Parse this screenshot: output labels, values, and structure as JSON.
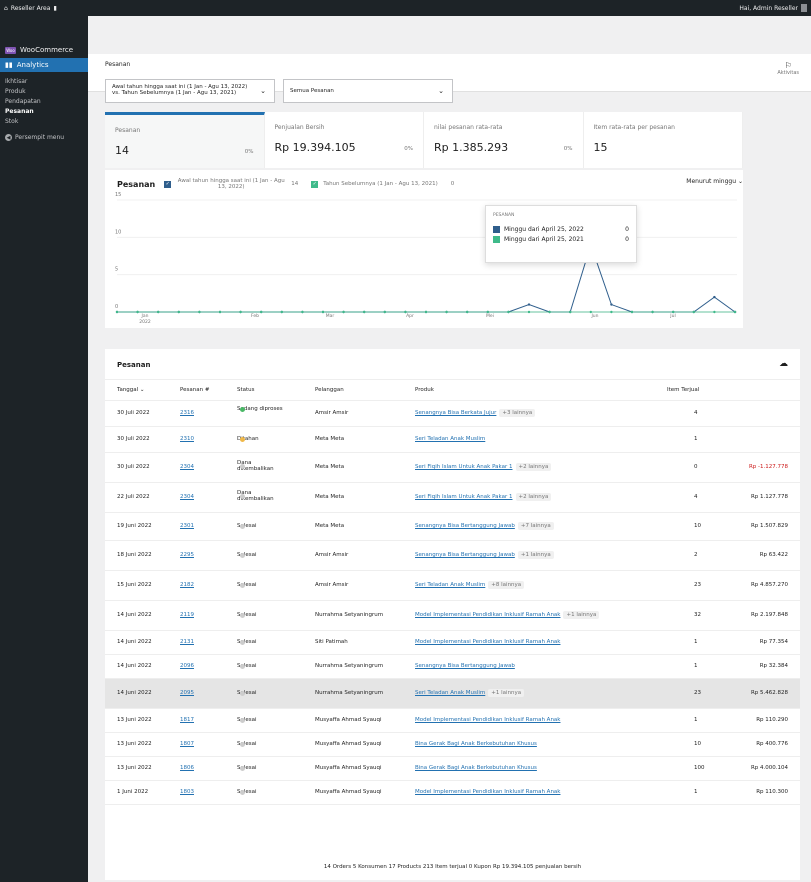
{
  "adminbar": {
    "site_title": "Reseller Area",
    "greeting": "Hai, Admin Reseller"
  },
  "sidebar": {
    "woocommerce": "WooCommerce",
    "analytics": "Analytics",
    "items": [
      {
        "label": "Ikhtisar"
      },
      {
        "label": "Produk"
      },
      {
        "label": "Pendapatan"
      },
      {
        "label": "Pesanan",
        "active": true
      },
      {
        "label": "Stok"
      }
    ],
    "collapse": "Persempit menu"
  },
  "header": {
    "title": "Pesanan",
    "activity": "Aktivitas"
  },
  "filters": {
    "date_range_line1": "Awal tahun hingga saat ini (1 Jan - Agu 13, 2022)",
    "date_range_line2": "vs. Tahun Sebelumnya (1 Jan - Agu 13, 2021)",
    "order_filter": "Semua Pesanan"
  },
  "summary": [
    {
      "label": "Pesanan",
      "value": "14",
      "pct": "0%"
    },
    {
      "label": "Penjualan Bersih",
      "value": "Rp 19.394.105",
      "pct": "0%"
    },
    {
      "label": "nilai pesanan rata-rata",
      "value": "Rp 1.385.293",
      "pct": "0%"
    },
    {
      "label": "Item rata-rata per pesanan",
      "value": "15",
      "pct": ""
    }
  ],
  "chart_header": {
    "title": "Pesanan",
    "series1_label": "Awal tahun hingga saat ini (1 Jan - Agu 13, 2022)",
    "series1_value": "14",
    "series2_label": "Tahun Sebelumnya (1 Jan - Agu 13, 2021)",
    "series2_value": "0",
    "interval": "Menurut minggu"
  },
  "tooltip": {
    "title": "PESANAN",
    "row1_label": "Minggu dari April 25, 2022",
    "row1_value": "0",
    "row2_label": "Minggu dari April 25, 2021",
    "row2_value": "0"
  },
  "colors": {
    "series1": "#2f5e8c",
    "series2": "#3fba8a",
    "accent": "#2271b1"
  },
  "chart_data": {
    "type": "line",
    "title": "Pesanan",
    "y_ticks": [
      "15",
      "10",
      "5",
      "0"
    ],
    "ylim": [
      0,
      15
    ],
    "x_tick_labels": [
      "Jan\n2022",
      "Feb",
      "Mar",
      "Apr",
      "Mei",
      "Jun",
      "Jul"
    ],
    "series": [
      {
        "name": "Awal tahun hingga saat ini (1 Jan - Agu 13, 2022)",
        "values": [
          0,
          0,
          0,
          0,
          0,
          0,
          0,
          0,
          0,
          0,
          0,
          0,
          0,
          0,
          0,
          0,
          0,
          0,
          0,
          0,
          1,
          0,
          0,
          9,
          1,
          0,
          0,
          0,
          0,
          2,
          0
        ]
      },
      {
        "name": "Tahun Sebelumnya (1 Jan - Agu 13, 2021)",
        "values": [
          0,
          0,
          0,
          0,
          0,
          0,
          0,
          0,
          0,
          0,
          0,
          0,
          0,
          0,
          0,
          0,
          0,
          0,
          0,
          0,
          0,
          0,
          0,
          0,
          0,
          0,
          0,
          0,
          0,
          0,
          0
        ]
      }
    ]
  },
  "table": {
    "title": "Pesanan",
    "columns": [
      "Tanggal",
      "Pesanan #",
      "Status",
      "Pelanggan",
      "Produk",
      "Item Terjual"
    ],
    "rows": [
      {
        "date": "30 Juli 2022",
        "order": "2316",
        "status": "Sedang diproses",
        "dot": "#4ab866",
        "customer": "Amsir Amsir",
        "product": "Senangnya Bisa Berkata Jujur",
        "more": "+3 lainnya",
        "items": "4",
        "total": ""
      },
      {
        "date": "30 Juli 2022",
        "order": "2310",
        "status": "Ditahan",
        "dot": "#f0b849",
        "customer": "Meta Meta",
        "product": "Seri Teladan Anak Muslim",
        "more": "",
        "items": "1",
        "total": ""
      },
      {
        "date": "30 Juli 2022",
        "order": "2304",
        "status": "Dana dikembalikan",
        "dot": "#ccc",
        "customer": "Meta Meta",
        "product": "Seri Fiqih Islam Untuk Anak Pakar 1",
        "more": "+2 lainnya",
        "items": "0",
        "total": "Rp -1.127.778",
        "neg": true
      },
      {
        "date": "22 Juli 2022",
        "order": "2304",
        "status": "Dana dikembalikan",
        "dot": "#ccc",
        "customer": "Meta Meta",
        "product": "Seri Fiqih Islam Untuk Anak Pakar 1",
        "more": "+2 lainnya",
        "items": "4",
        "total": "Rp 1.127.778"
      },
      {
        "date": "19 Juni 2022",
        "order": "2301",
        "status": "Selesai",
        "dot": "#ccc",
        "customer": "Meta Meta",
        "product": "Senangnya Bisa Bertanggung Jawab",
        "more": "+7 lainnya",
        "items": "10",
        "total": "Rp 1.507.829"
      },
      {
        "date": "18 Juni 2022",
        "order": "2295",
        "status": "Selesai",
        "dot": "#ccc",
        "customer": "Amsir Amsir",
        "product": "Senangnya Bisa Bertanggung Jawab",
        "more": "+1 lainnya",
        "items": "2",
        "total": "Rp 63.422"
      },
      {
        "date": "15 Juni 2022",
        "order": "2182",
        "status": "Selesai",
        "dot": "#ccc",
        "customer": "Amsir Amsir",
        "product": "Seri Teladan Anak Muslim",
        "more": "+8 lainnya",
        "items": "23",
        "total": "Rp 4.857.270"
      },
      {
        "date": "14 Juni 2022",
        "order": "2119",
        "status": "Selesai",
        "dot": "#ccc",
        "customer": "Nurrahma Setyaningrum",
        "product": "Model Implementasi Pendidikan Inklusif Ramah Anak",
        "more": "+1 lainnya",
        "items": "32",
        "total": "Rp 2.197.848"
      },
      {
        "date": "14 Juni 2022",
        "order": "2131",
        "status": "Selesai",
        "dot": "#ccc",
        "customer": "Siti Patimah",
        "product": "Model Implementasi Pendidikan Inklusif Ramah Anak",
        "more": "",
        "items": "1",
        "total": "Rp 77.354"
      },
      {
        "date": "14 Juni 2022",
        "order": "2096",
        "status": "Selesai",
        "dot": "#ccc",
        "customer": "Nurrahma Setyaningrum",
        "product": "Senangnya Bisa Bertanggung Jawab",
        "more": "",
        "items": "1",
        "total": "Rp 32.384"
      },
      {
        "date": "14 Juni 2022",
        "order": "2095",
        "status": "Selesai",
        "dot": "#ccc",
        "customer": "Nurrahma Setyaningrum",
        "product": "Seri Teladan Anak Muslim",
        "more": "+1 lainnya",
        "items": "23",
        "total": "Rp 5.462.828",
        "highlight": true
      },
      {
        "date": "13 Juni 2022",
        "order": "1817",
        "status": "Selesai",
        "dot": "#ccc",
        "customer": "Musyaffa Ahmad Syauqi",
        "product": "Model Implementasi Pendidikan Inklusif Ramah Anak",
        "more": "",
        "items": "1",
        "total": "Rp 110.290"
      },
      {
        "date": "13 Juni 2022",
        "order": "1807",
        "status": "Selesai",
        "dot": "#ccc",
        "customer": "Musyaffa Ahmad Syauqi",
        "product": "Bina Gerak Bagi Anak Berkebutuhan Khusus",
        "more": "",
        "items": "10",
        "total": "Rp 400.776"
      },
      {
        "date": "13 Juni 2022",
        "order": "1806",
        "status": "Selesai",
        "dot": "#ccc",
        "customer": "Musyaffa Ahmad Syauqi",
        "product": "Bina Gerak Bagi Anak Berkebutuhan Khusus",
        "more": "",
        "items": "100",
        "total": "Rp 4.000.104"
      },
      {
        "date": "1 Juni 2022",
        "order": "1803",
        "status": "Selesai",
        "dot": "#ccc",
        "customer": "Musyaffa Ahmad Syauqi",
        "product": "Model Implementasi Pendidikan Inklusif Ramah Anak",
        "more": "",
        "items": "1",
        "total": "Rp 110.300"
      }
    ],
    "totals": "14 Orders   5 Konsumen   17 Products   213 Item terjual   0 Kupon   Rp 19.394.105 penjualan bersih"
  }
}
